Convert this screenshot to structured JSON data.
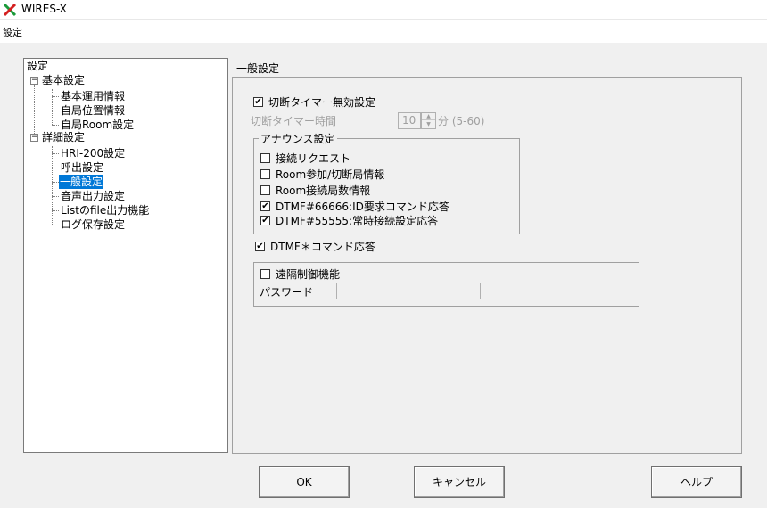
{
  "window": {
    "title": "WIRES-X",
    "icon": "wires-x-logo-icon"
  },
  "menu": {
    "settings": "設定"
  },
  "tree": {
    "root": "設定",
    "basic": {
      "label": "基本設定",
      "children": [
        "基本運用情報",
        "自局位置情報",
        "自局Room設定"
      ]
    },
    "detail": {
      "label": "詳細設定",
      "children": [
        "HRI-200設定",
        "呼出設定",
        "一般設定",
        "音声出力設定",
        "Listのfile出力機能",
        "ログ保存設定"
      ]
    },
    "selected": "一般設定",
    "expander_symbol": "−"
  },
  "panel": {
    "title": "一般設定",
    "disconnect_timer_disable": {
      "label": "切断タイマー無効設定",
      "checked": true
    },
    "disconnect_timer": {
      "label": "切断タイマー時間",
      "value": "10",
      "unit": "分 (5-60)"
    },
    "announce": {
      "legend": "アナウンス設定",
      "items": [
        {
          "label": "接続リクエスト",
          "checked": false
        },
        {
          "label": "Room参加/切断局情報",
          "checked": false
        },
        {
          "label": "Room接続局数情報",
          "checked": false
        },
        {
          "label": "DTMF#66666:ID要求コマンド応答",
          "checked": true
        },
        {
          "label": "DTMF#55555:常時接続設定応答",
          "checked": true
        }
      ]
    },
    "dtmf_star": {
      "label": "DTMF＊コマンド応答",
      "checked": true
    },
    "remote": {
      "label": "遠隔制御機能",
      "checked": false,
      "password_label": "パスワード",
      "password_value": ""
    }
  },
  "buttons": {
    "ok": "OK",
    "cancel": "キャンセル",
    "help": "ヘルプ"
  },
  "glyphs": {
    "check": "✔",
    "spin_up": "▲",
    "spin_down": "▼"
  },
  "colors": {
    "selection": "#0078d7",
    "logo_red": "#d42020",
    "logo_green": "#1a9a3a"
  }
}
